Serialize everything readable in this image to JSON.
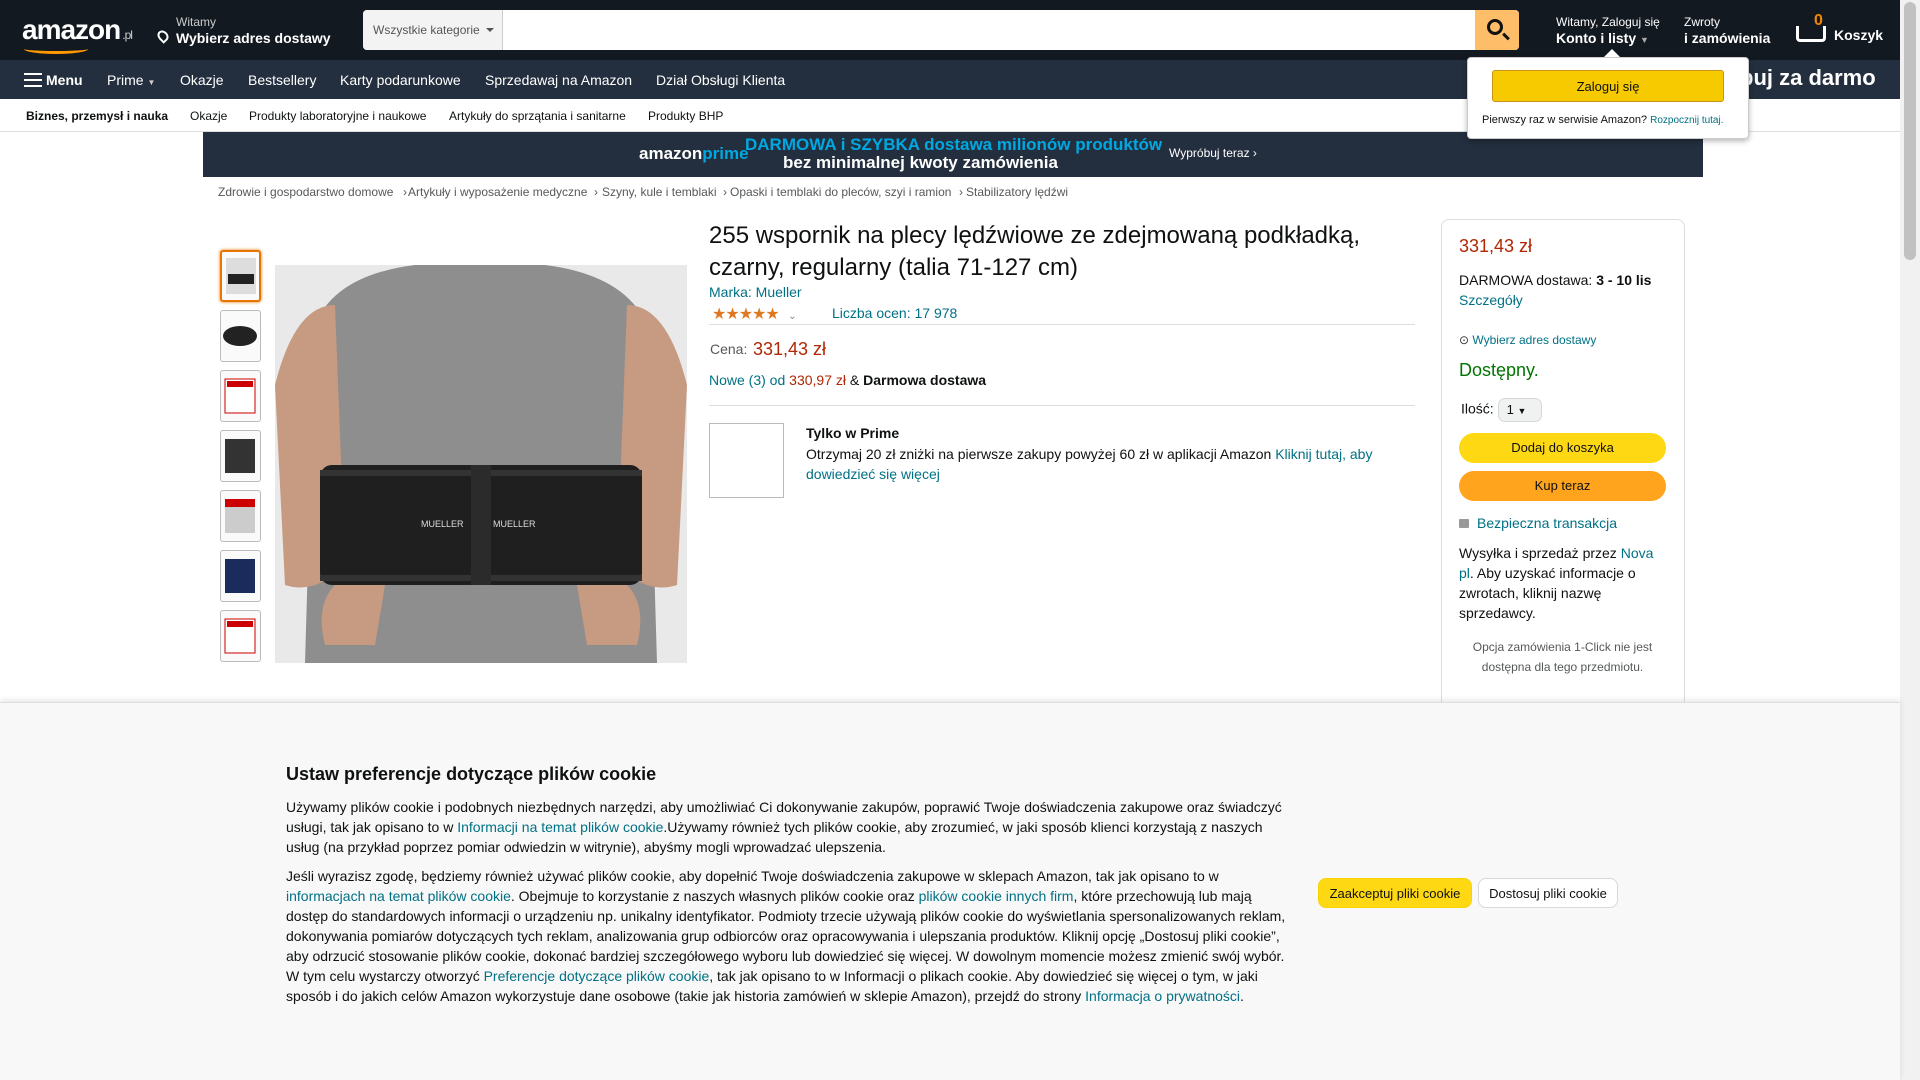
{
  "header": {
    "logo": "amazon",
    "logo_tld": ".pl",
    "deliver_top": "Witamy",
    "deliver_bottom": "Wybierz adres dostawy",
    "search_category": "Wszystkie kategorie",
    "search_placeholder": "",
    "account_top": "Witamy, Zaloguj się",
    "account_bottom": "Konto i listy",
    "returns_top": "Zwroty",
    "returns_bottom": "i zamówienia",
    "cart_count": "0",
    "cart_label": "Koszyk"
  },
  "subnav": {
    "menu": "Menu",
    "items": [
      "Prime",
      "Okazje",
      "Bestsellery",
      "Karty podarunkowe",
      "Sprzedawaj na Amazon",
      "Dział Obsługi Klienta"
    ],
    "promo": "buj za darmo"
  },
  "catbar": {
    "items": [
      "Biznes, przemysł i nauka",
      "Okazje",
      "Produkty laboratoryjne i naukowe",
      "Artykuły do sprzątania i sanitarne",
      "Produkty BHP"
    ]
  },
  "banner": {
    "logo_a": "amazon",
    "logo_b": "prime",
    "line1": "DARMOWA i SZYBKA dostawa milionów produktów",
    "line2": "bez minimalnej kwoty zamówienia",
    "cta": "Wypróbuj teraz ›"
  },
  "breadcrumbs": [
    "Zdrowie i gospodarstwo domowe",
    "Artykuły i wyposażenie medyczne",
    "Szyny, kule i temblaki",
    "Opaski i temblaki do pleców, szyi i ramion",
    "Stabilizatory lędźwi"
  ],
  "product": {
    "title": "255 wspornik na plecy lędźwiowe ze zdejmowaną podkładką, czarny, regularny (talia 71-127 cm)",
    "brand": "Marka: Mueller",
    "stars": "★★★★★",
    "rating_value": 4.5,
    "ratings": "Liczba ocen: 17 978",
    "price_label": "Cena:",
    "price": "331,43 zł",
    "offers_link": "Nowe (3) od",
    "offers_price": "330,97 zł",
    "offers_amp": "&",
    "offers_free": "Darmowa dostawa",
    "prime_title": "Tylko w Prime",
    "prime_text": "Otrzymaj 20 zł zniżki na pierwsze zakupy powyżej 60 zł w aplikacji Amazon",
    "prime_link": "Kliknij tutaj, aby dowiedzieć się więcej",
    "image_logo": "MUELLER"
  },
  "buybox": {
    "price": "331,43 zł",
    "delivery_prefix": "DARMOWA dostawa:",
    "delivery_date": "3 - 10 lis",
    "details": "Szczegóły",
    "address": "Wybierz adres dostawy",
    "availability": "Dostępny.",
    "qty_label": "Ilość:",
    "qty": "1",
    "add_to_cart": "Dodaj do koszyka",
    "buy_now": "Kup teraz",
    "secure": "Bezpieczna transakcja",
    "ship_prefix": "Wysyłka i sprzedaż przez",
    "seller": "Nova pl",
    "ship_suffix": ". Aby uzyskać informacje o zwrotach, kliknij nazwę sprzedawcy.",
    "oneclick": "Opcja zamówienia 1-Click nie jest dostępna dla tego przedmiotu."
  },
  "signin_popup": {
    "button": "Zaloguj się",
    "new_text": "Pierwszy raz w serwisie Amazon?",
    "new_link": "Rozpocznij tutaj."
  },
  "cookie": {
    "title": "Ustaw preferencje dotyczące plików cookie",
    "p1a": "Używamy plików cookie i podobnych niezbędnych narzędzi, aby umożliwiać Ci dokonywanie zakupów, poprawić Twoje doświadczenia zakupowe oraz świadczyć usługi, tak jak opisano to w ",
    "p1link": "Informacji na temat plików cookie",
    "p1b": ".Używamy również tych plików cookie, aby zrozumieć, w jaki sposób klienci korzystają z naszych usług (na przykład poprzez pomiar odwiedzin w witrynie), abyśmy mogli wprowadzać ulepszenia.",
    "p2a": "Jeśli wyrazisz zgodę, będziemy również używać plików cookie, aby dopełnić Twoje doświadczenia zakupowe w sklepach Amazon, tak jak opisano to w ",
    "p2link1": "informacjach na temat plików cookie",
    "p2b": ". Obejmuje to korzystanie z naszych własnych plików cookie oraz ",
    "p2link2": "plików cookie innych firm",
    "p2c": ", które przechowują lub mają dostęp do standardowych informacji o urządzeniu np. unikalny identyfikator. Podmioty trzecie używają plików cookie do wyświetlania spersonalizowanych reklam, dokonywania pomiarów dotyczących tych reklam, analizowania grup odbiorców oraz opracowywania i ulepszania produktów. Kliknij opcję „Dostosuj pliki cookie”, aby odrzucić stosowanie plików cookie, dokonać bardziej szczegółowego wyboru lub dowiedzieć się więcej. W dowolnym momencie możesz zmienić swój wybór. W tym celu wystarczy otworzyć ",
    "p2link3": "Preferencje dotyczące plików cookie",
    "p2d": ", tak jak opisano to w Informacji o plikach cookie. Aby dowiedzieć się więcej o tym, w jaki sposób i do jakich celów Amazon wykorzystuje dane osobowe (takie jak historia zamówień w sklepie Amazon), przejdź do strony ",
    "p2link4": "Informacja o prywatności",
    "p2e": ".",
    "accept": "Zaakceptuj pliki cookie",
    "customize": "Dostosuj pliki cookie"
  },
  "colors": {
    "nav": "#131921",
    "subnav": "#232f3e",
    "accent": "#ff9900",
    "link": "#007185",
    "price": "#b12704",
    "cart_btn": "#ffd814",
    "buy_btn": "#ffa41c",
    "available": "#007600"
  }
}
